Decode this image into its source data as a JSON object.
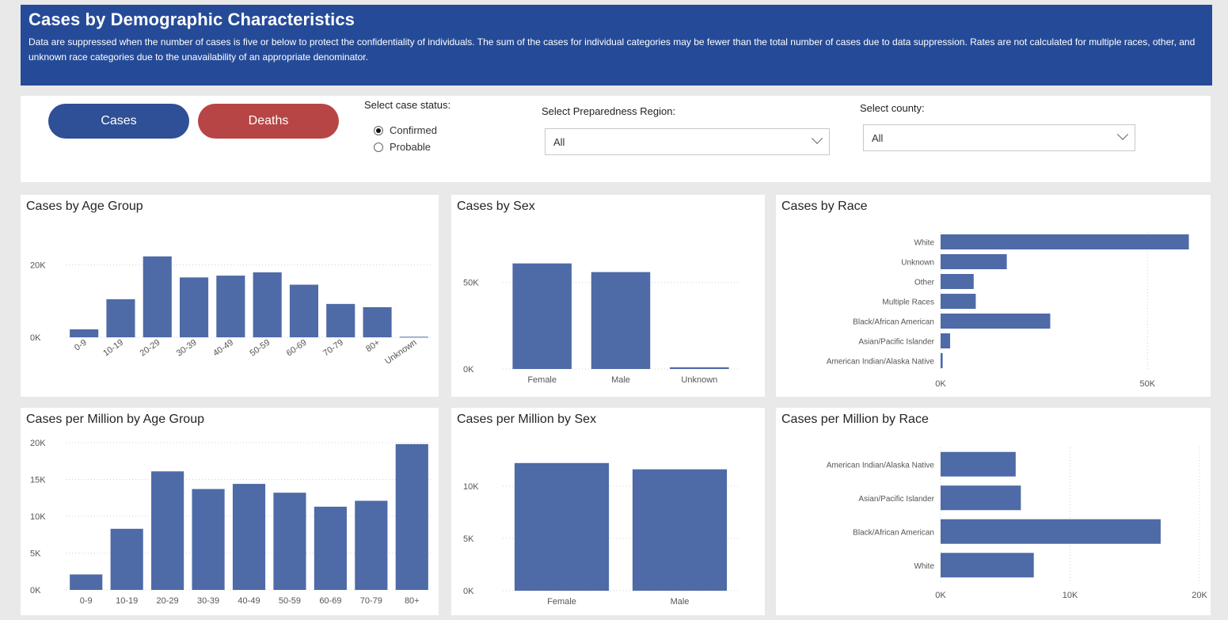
{
  "header": {
    "title": "Cases by Demographic Characteristics",
    "description": "Data are suppressed when the number of cases is five or below to protect the confidentiality of individuals. The sum of the cases for individual categories may be fewer than the total number of cases due to data suppression.  Rates are not calculated for multiple races, other, and unknown race categories due to the unavailability of an appropriate denominator."
  },
  "filters": {
    "cases_label": "Cases",
    "deaths_label": "Deaths",
    "case_status_label": "Select case status:",
    "case_status_options": [
      "Confirmed",
      "Probable"
    ],
    "case_status_selected": "Confirmed",
    "region_label": "Select Preparedness Region:",
    "region_value": "All",
    "county_label": "Select county:",
    "county_value": "All"
  },
  "colors": {
    "bar": "#4e6aa7",
    "header": "#254b98",
    "cases_button": "#2f4f96",
    "deaths_button": "#b84545"
  },
  "chart_data": [
    {
      "id": "age",
      "type": "bar",
      "title": "Cases by Age Group",
      "categories": [
        "0-9",
        "10-19",
        "20-29",
        "30-39",
        "40-49",
        "50-59",
        "60-69",
        "70-79",
        "80+",
        "Unknown"
      ],
      "values": [
        2200,
        10500,
        22300,
        16500,
        17000,
        17900,
        14500,
        9200,
        8300,
        150
      ],
      "yticks": [
        0,
        20000
      ],
      "ytick_labels": [
        "0K",
        "20K"
      ],
      "ylim": [
        0,
        24000
      ],
      "grid": true
    },
    {
      "id": "sex",
      "type": "bar",
      "title": "Cases by Sex",
      "categories": [
        "Female",
        "Male",
        "Unknown"
      ],
      "values": [
        61000,
        56000,
        1000
      ],
      "yticks": [
        0,
        50000
      ],
      "ytick_labels": [
        "0K",
        "50K"
      ],
      "ylim": [
        0,
        70000
      ],
      "grid": true
    },
    {
      "id": "race",
      "type": "hbar",
      "title": "Cases by Race",
      "categories": [
        "White",
        "Unknown",
        "Other",
        "Multiple Races",
        "Black/African American",
        "Asian/Pacific Islander",
        "American Indian/Alaska Native"
      ],
      "values": [
        60000,
        16000,
        8000,
        8500,
        26500,
        2300,
        500
      ],
      "xticks": [
        0,
        50000
      ],
      "xtick_labels": [
        "0K",
        "50K"
      ],
      "xlim": [
        0,
        62000
      ],
      "grid": true
    },
    {
      "id": "age_rate",
      "type": "bar",
      "title": "Cases per Million by Age Group",
      "categories": [
        "0-9",
        "10-19",
        "20-29",
        "30-39",
        "40-49",
        "50-59",
        "60-69",
        "70-79",
        "80+"
      ],
      "values": [
        2100,
        8300,
        16100,
        13700,
        14400,
        13200,
        11300,
        12100,
        19800
      ],
      "yticks": [
        0,
        5000,
        10000,
        15000,
        20000
      ],
      "ytick_labels": [
        "0K",
        "5K",
        "10K",
        "15K",
        "20K"
      ],
      "ylim": [
        0,
        20000
      ],
      "grid": true
    },
    {
      "id": "sex_rate",
      "type": "bar",
      "title": "Cases per Million by Sex",
      "categories": [
        "Female",
        "Male"
      ],
      "values": [
        12200,
        11600
      ],
      "yticks": [
        0,
        5000,
        10000
      ],
      "ytick_labels": [
        "0K",
        "5K",
        "10K"
      ],
      "ylim": [
        0,
        14000
      ],
      "grid": true
    },
    {
      "id": "race_rate",
      "type": "hbar",
      "title": "Cases per Million by Race",
      "categories": [
        "American Indian/Alaska Native",
        "Asian/Pacific Islander",
        "Black/African American",
        "White"
      ],
      "values": [
        5800,
        6200,
        17000,
        7200
      ],
      "xticks": [
        0,
        10000,
        20000
      ],
      "xtick_labels": [
        "0K",
        "10K",
        "20K"
      ],
      "xlim": [
        0,
        20000
      ],
      "grid": true
    }
  ]
}
